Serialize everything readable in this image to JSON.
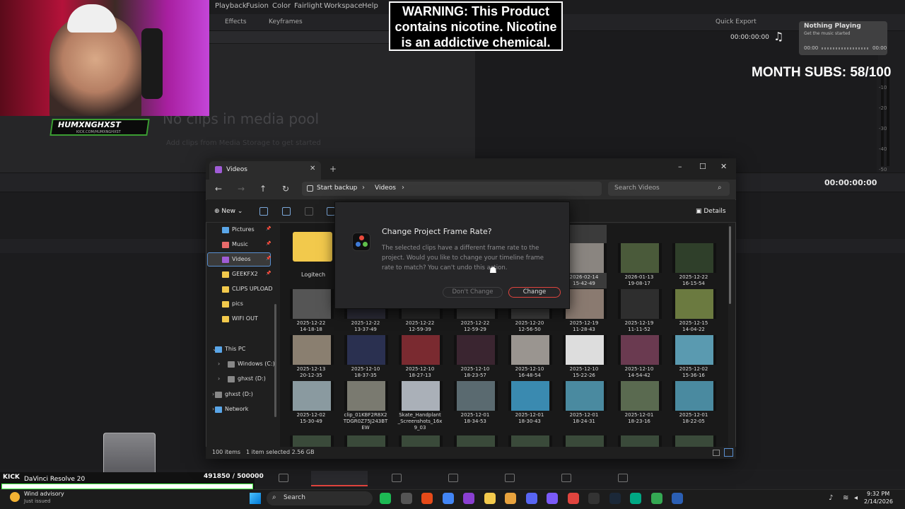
{
  "resolve": {
    "menu": [
      "Playback",
      "Fusion",
      "Color",
      "Fairlight",
      "Workspace",
      "Help"
    ],
    "toolbar": {
      "effects": "Effects",
      "keyframes": "Keyframes",
      "quick_export": "Quick Export"
    },
    "timecode_top": "00:00:00:00",
    "timecode_right": "00:00:00:00",
    "media_pool_empty_title": "No clips in media pool",
    "media_pool_empty_sub": "Add clips from Media Storage to get started",
    "meter_labels": [
      "-10",
      "-20",
      "-30",
      "-40",
      "-50"
    ]
  },
  "overlay": {
    "nameplate": "HUMXNGHXST",
    "nameplate_sub": "KICK.COM/HUMXNGHXST",
    "warning": "WARNING: This Product contains nicotine. Nicotine is an addictive chemical.",
    "subs": "MONTH SUBS: 58/100",
    "now_playing_title": "Nothing Playing",
    "now_playing_sub": "Get the music started",
    "now_playing_time_a": "00:00",
    "now_playing_time_b": "00:00",
    "kick_label": "KICK",
    "kick_app": "DaVinci Resolve 20",
    "kick_count": "491850   / 500000",
    "kick_progress": 0.98
  },
  "explorer": {
    "tab_title": "Videos",
    "breadcrumb": [
      "Start backup",
      "Videos"
    ],
    "search_placeholder": "Search Videos",
    "new_label": "New",
    "details_label": "Details",
    "nav": [
      {
        "label": "Pictures",
        "icon_color": "#5aa6e8",
        "pinned": true
      },
      {
        "label": "Music",
        "icon_color": "#e86a6a",
        "pinned": true
      },
      {
        "label": "Videos",
        "icon_color": "#a05cd6",
        "pinned": true,
        "selected": true
      },
      {
        "label": "GEEKFX2",
        "icon_color": "#f2c94c",
        "pinned": true
      },
      {
        "label": "CLIPS UPLOAD",
        "icon_color": "#f2c94c",
        "pinned": false
      },
      {
        "label": "pics",
        "icon_color": "#f2c94c",
        "pinned": false
      },
      {
        "label": "WIFI OUT",
        "icon_color": "#f2c94c",
        "pinned": false
      },
      {
        "label": "This PC",
        "icon_color": "#5aa6e8",
        "pinned": false
      },
      {
        "label": "Windows (C:)",
        "icon_color": "#888888",
        "pinned": false
      },
      {
        "label": "ghxst (D:)",
        "icon_color": "#888888",
        "pinned": false
      },
      {
        "label": "ghxst (D:)",
        "icon_color": "#888888",
        "pinned": false
      },
      {
        "label": "Network",
        "icon_color": "#5aa6e8",
        "pinned": false
      }
    ],
    "folder_label": "Logitech",
    "tiles": [
      {
        "caption": "2026-02-14\n15-42-49",
        "color": "#8a8580",
        "selected": true
      },
      {
        "caption": "2026-01-13\n19-08-17",
        "color": "#4a5a3a"
      },
      {
        "caption": "2025-12-22\n16-15-54",
        "color": "#2f3f2a"
      },
      {
        "caption": "2025-12-22\n14-18-18",
        "color": "#555555"
      },
      {
        "caption": "2025-12-22\n13-37-49",
        "color": "#2a2a35"
      },
      {
        "caption": "2025-12-22\n12-59-39",
        "color": "#252525"
      },
      {
        "caption": "2025-12-22\n12-59-29",
        "color": "#303030"
      },
      {
        "caption": "2025-12-20\n12-56-50",
        "color": "#3a3a3a"
      },
      {
        "caption": "2025-12-19\n11-28-43",
        "color": "#8a7a70"
      },
      {
        "caption": "2025-12-19\n11-11-52",
        "color": "#2e2e2e"
      },
      {
        "caption": "2025-12-15\n14-04-22",
        "color": "#6b7a40"
      },
      {
        "caption": "2025-12-13\n20-12-35",
        "color": "#8a7f70"
      },
      {
        "caption": "2025-12-10\n18-37-35",
        "color": "#2a3050"
      },
      {
        "caption": "2025-12-10\n18-27-13",
        "color": "#7a2a30"
      },
      {
        "caption": "2025-12-10\n18-23-57",
        "color": "#3a2530"
      },
      {
        "caption": "2025-12-10\n16-48-54",
        "color": "#9a9590"
      },
      {
        "caption": "2025-12-10\n15-22-26",
        "color": "#dddddd"
      },
      {
        "caption": "2025-12-10\n14-54-42",
        "color": "#6a3a50"
      },
      {
        "caption": "2025-12-02\n15-36-16",
        "color": "#5a9ab0"
      },
      {
        "caption": "2025-12-02\n15-30-49",
        "color": "#8a9aa0"
      },
      {
        "caption": "clip_01KBF2R8X2\nTDGR0Z75J243BT\nEW",
        "color": "#7a7a70"
      },
      {
        "caption": "Skate_Handplant\n_Screenshots_16x\n9_03",
        "color": "#aab0b8"
      },
      {
        "caption": "2025-12-01\n18-34-53",
        "color": "#5a6a70"
      },
      {
        "caption": "2025-12-01\n18-30-43",
        "color": "#3a8ab0"
      },
      {
        "caption": "2025-12-01\n18-24-31",
        "color": "#4a8aa0"
      },
      {
        "caption": "2025-12-01\n18-23-16",
        "color": "#5a6a50"
      },
      {
        "caption": "2025-12-01\n18-22-05",
        "color": "#4a8aa0"
      }
    ],
    "status_count": "100 items",
    "status_sel": "1 item selected  2.56 GB"
  },
  "dialog": {
    "title": "Change Project Frame Rate?",
    "body": "The selected clips have a different frame rate to the project. Would you like to change your timeline frame rate to match? You can't undo this action.",
    "dont_change": "Don't Change",
    "change": "Change"
  },
  "taskbar": {
    "weather_title": "Wind advisory",
    "weather_sub": "Just issued",
    "search_label": "Search",
    "time": "9:32 PM",
    "date": "2/14/2026",
    "apps": [
      "#1db954",
      "#555555",
      "#e64a19",
      "#4285f4",
      "#8a3fd1",
      "#f2c94c",
      "#e8a33d",
      "#5865f2",
      "#7a5af8",
      "#e0443e",
      "#333333",
      "#1b2838",
      "#00a884",
      "#34a853",
      "#2b5fb4"
    ]
  }
}
